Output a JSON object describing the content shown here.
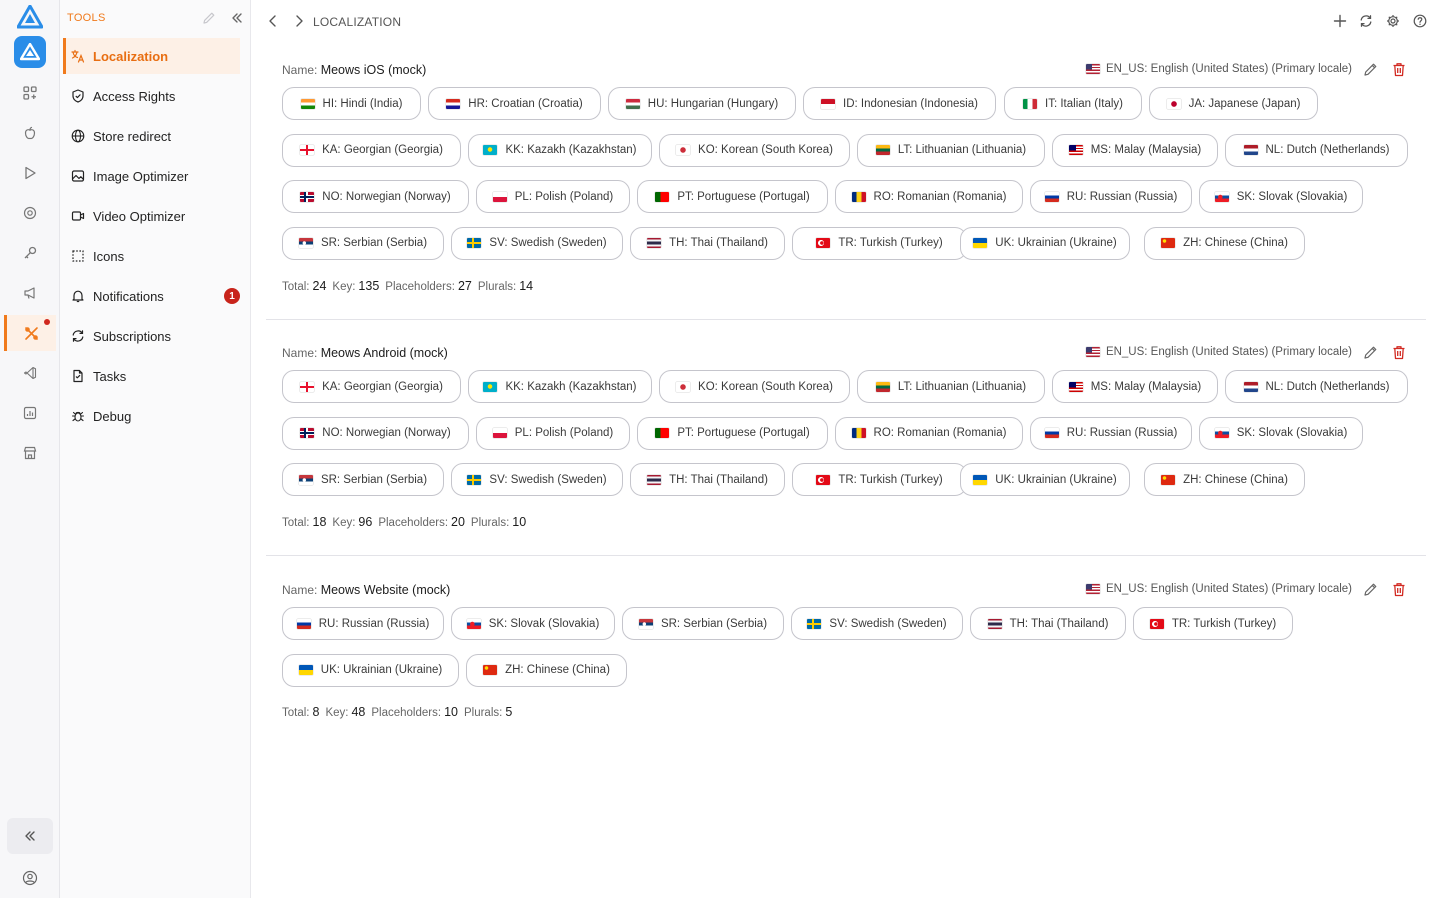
{
  "colors": {
    "accent": "#f07a1c",
    "danger": "#d22a22",
    "brand": "#2a8de8"
  },
  "tools": {
    "header": "TOOLS",
    "items": [
      {
        "label": "Localization",
        "icon": "translate-icon",
        "active": true
      },
      {
        "label": "Access Rights",
        "icon": "shield-icon"
      },
      {
        "label": "Store redirect",
        "icon": "globe-icon"
      },
      {
        "label": "Image Optimizer",
        "icon": "image-icon"
      },
      {
        "label": "Video Optimizer",
        "icon": "video-icon"
      },
      {
        "label": "Icons",
        "icon": "icons-grid-icon"
      },
      {
        "label": "Notifications",
        "icon": "bell-icon",
        "badge": "1"
      },
      {
        "label": "Subscriptions",
        "icon": "refresh-icon"
      },
      {
        "label": "Tasks",
        "icon": "document-icon"
      },
      {
        "label": "Debug",
        "icon": "bug-icon"
      }
    ]
  },
  "topbar": {
    "breadcrumb": "LOCALIZATION"
  },
  "labels": {
    "name": "Name:",
    "total": "Total:",
    "key": "Key:",
    "placeholders": "Placeholders:",
    "plurals": "Plurals:"
  },
  "projects": [
    {
      "name": "Meows iOS (mock)",
      "primary_locale": "EN_US: English (United States) (Primary locale)",
      "locales": [
        "HI: Hindi (India)",
        "HR: Croatian (Croatia)",
        "HU: Hungarian (Hungary)",
        "ID: Indonesian (Indonesia)",
        "IT: Italian (Italy)",
        "JA: Japanese (Japan)",
        "KA: Georgian (Georgia)",
        "KK: Kazakh (Kazakhstan)",
        "KO: Korean (South Korea)",
        "LT: Lithuanian (Lithuania)",
        "MS: Malay (Malaysia)",
        "NL: Dutch (Netherlands)",
        "NO: Norwegian (Norway)",
        "PL: Polish (Poland)",
        "PT: Portuguese (Portugal)",
        "RO: Romanian (Romania)",
        "RU: Russian (Russia)",
        "SK: Slovak (Slovakia)",
        "SR: Serbian (Serbia)",
        "SV: Swedish (Sweden)",
        "TH: Thai (Thailand)",
        "TR: Turkish (Turkey)",
        "UK: Ukrainian (Ukraine)",
        "ZH: Chinese (China)"
      ],
      "stats": {
        "total": "24",
        "key": "135",
        "placeholders": "27",
        "plurals": "14"
      }
    },
    {
      "name": "Meows Android (mock)",
      "primary_locale": "EN_US: English (United States) (Primary locale)",
      "locales": [
        "KA: Georgian (Georgia)",
        "KK: Kazakh (Kazakhstan)",
        "KO: Korean (South Korea)",
        "LT: Lithuanian (Lithuania)",
        "MS: Malay (Malaysia)",
        "NL: Dutch (Netherlands)",
        "NO: Norwegian (Norway)",
        "PL: Polish (Poland)",
        "PT: Portuguese (Portugal)",
        "RO: Romanian (Romania)",
        "RU: Russian (Russia)",
        "SK: Slovak (Slovakia)",
        "SR: Serbian (Serbia)",
        "SV: Swedish (Sweden)",
        "TH: Thai (Thailand)",
        "TR: Turkish (Turkey)",
        "UK: Ukrainian (Ukraine)",
        "ZH: Chinese (China)"
      ],
      "stats": {
        "total": "18",
        "key": "96",
        "placeholders": "20",
        "plurals": "10"
      }
    },
    {
      "name": "Meows Website (mock)",
      "primary_locale": "EN_US: English (United States) (Primary locale)",
      "locales": [
        "RU: Russian (Russia)",
        "SK: Slovak (Slovakia)",
        "SR: Serbian (Serbia)",
        "SV: Swedish (Sweden)",
        "TH: Thai (Thailand)",
        "TR: Turkish (Turkey)",
        "UK: Ukrainian (Ukraine)",
        "ZH: Chinese (China)"
      ],
      "stats": {
        "total": "8",
        "key": "48",
        "placeholders": "10",
        "plurals": "5"
      }
    }
  ]
}
